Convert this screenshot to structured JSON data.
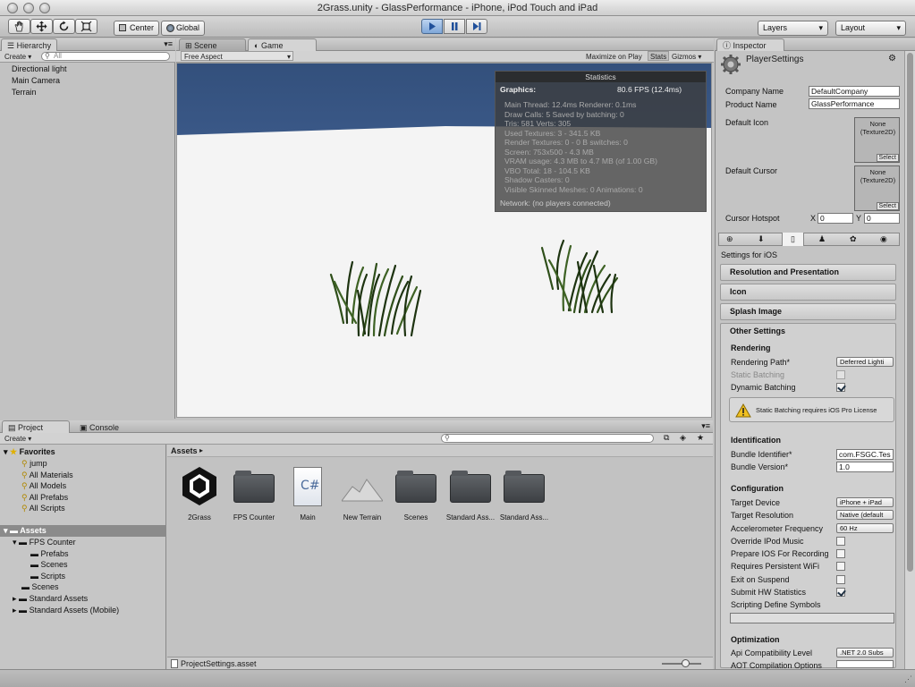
{
  "window": {
    "title": "2Grass.unity - GlassPerformance - iPhone, iPod Touch and iPad"
  },
  "toolbar": {
    "center_label": "Center",
    "global_label": "Global",
    "layers_label": "Layers",
    "layout_label": "Layout"
  },
  "hierarchy": {
    "tab": "Hierarchy",
    "create": "Create",
    "search_placeholder": "All",
    "items": [
      "Directional light",
      "Main Camera",
      "Terrain"
    ]
  },
  "scene_tab": "Scene",
  "game": {
    "tab": "Game",
    "aspect": "Free Aspect",
    "maximize": "Maximize on Play",
    "stats_btn": "Stats",
    "gizmos": "Gizmos"
  },
  "stats": {
    "header": "Statistics",
    "graphics_label": "Graphics:",
    "fps": "80.6 FPS (12.4ms)",
    "lines": [
      "Main Thread: 12.4ms  Renderer: 0.1ms",
      "Draw Calls: 5  Saved by batching: 0",
      "Tris: 581   Verts: 305",
      "Used Textures: 3 - 341.5 KB",
      "Render Textures: 0 - 0 B  switches: 0",
      "Screen: 753x500 - 4.3 MB",
      "VRAM usage: 4.3 MB to 4.7 MB (of 1.00 GB)",
      "VBO Total: 18 - 104.5 KB",
      "Shadow Casters: 0",
      "Visible Skinned Meshes: 0     Animations: 0"
    ],
    "network": "Network: (no players connected)"
  },
  "project": {
    "tab": "Project",
    "console_tab": "Console",
    "create": "Create",
    "favorites": "Favorites",
    "fav_items": [
      "jump",
      "All Materials",
      "All Models",
      "All Prefabs",
      "All Scripts"
    ],
    "assets_root": "Assets",
    "tree": {
      "fps_counter": "FPS Counter",
      "prefabs": "Prefabs",
      "scenes_sub": "Scenes",
      "scripts": "Scripts",
      "scenes": "Scenes",
      "std": "Standard Assets",
      "std_mobile": "Standard Assets (Mobile)"
    },
    "breadcrumb": "Assets",
    "assets": [
      "2Grass",
      "FPS Counter",
      "Main",
      "New Terrain",
      "Scenes",
      "Standard Ass...",
      "Standard Ass..."
    ],
    "footer_file": "ProjectSettings.asset"
  },
  "inspector": {
    "tab": "Inspector",
    "title": "PlayerSettings",
    "company_label": "Company Name",
    "company_value": "DefaultCompany",
    "product_label": "Product Name",
    "product_value": "GlassPerformance",
    "icon_label": "Default Icon",
    "cursor_label": "Default Cursor",
    "none_texture": "None (Texture2D)",
    "select": "Select",
    "hotspot_label": "Cursor Hotspot",
    "x_label": "X",
    "x_value": "0",
    "y_label": "Y",
    "y_value": "0",
    "settings_for": "Settings for iOS",
    "sections": [
      "Resolution and Presentation",
      "Icon",
      "Splash Image"
    ],
    "other_settings": "Other Settings",
    "rendering": "Rendering",
    "rendering_path_label": "Rendering Path*",
    "rendering_path_value": "Deferred Lighti",
    "static_batching": "Static Batching",
    "dynamic_batching": "Dynamic Batching",
    "warning": "Static Batching requires iOS Pro License",
    "identification": "Identification",
    "bundle_id_label": "Bundle Identifier*",
    "bundle_id_value": "com.FSGC.Tes",
    "bundle_ver_label": "Bundle Version*",
    "bundle_ver_value": "1.0",
    "configuration": "Configuration",
    "target_device_label": "Target Device",
    "target_device_value": "iPhone + iPad",
    "target_res_label": "Target Resolution",
    "target_res_value": "Native (default",
    "accel_label": "Accelerometer Frequency",
    "accel_value": "60 Hz",
    "override_ipod": "Override IPod Music",
    "prepare_ios": "Prepare IOS For Recording",
    "persistent_wifi": "Requires Persistent WiFi",
    "exit_suspend": "Exit on Suspend",
    "submit_hw": "Submit HW Statistics",
    "scripting_symbols": "Scripting Define Symbols",
    "optimization": "Optimization",
    "api_label": "Api Compatibility Level",
    "api_value": ".NET 2.0 Subs",
    "aot_label": "AOT Compilation Options"
  }
}
